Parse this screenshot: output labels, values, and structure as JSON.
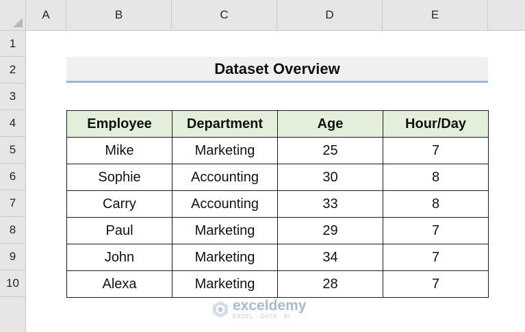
{
  "columns": [
    "A",
    "B",
    "C",
    "D",
    "E"
  ],
  "rows": [
    "1",
    "2",
    "3",
    "4",
    "5",
    "6",
    "7",
    "8",
    "9",
    "10"
  ],
  "title": "Dataset Overview",
  "table": {
    "headers": [
      "Employee",
      "Department",
      "Age",
      "Hour/Day"
    ],
    "rows": [
      [
        "Mike",
        "Marketing",
        "25",
        "7"
      ],
      [
        "Sophie",
        "Accounting",
        "30",
        "8"
      ],
      [
        "Carry",
        "Accounting",
        "33",
        "8"
      ],
      [
        "Paul",
        "Marketing",
        "29",
        "7"
      ],
      [
        "John",
        "Marketing",
        "34",
        "7"
      ],
      [
        "Alexa",
        "Marketing",
        "28",
        "7"
      ]
    ]
  },
  "watermark": {
    "name": "exceldemy",
    "tagline": "EXCEL · DATA · BI",
    "color": "#6e8fb6"
  },
  "colors": {
    "header_fill": "#e3efdb",
    "title_underline": "#9db4d9",
    "title_fill": "#f0f0f0"
  }
}
